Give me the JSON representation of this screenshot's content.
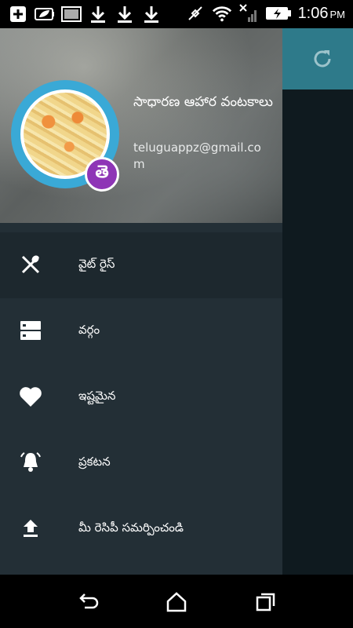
{
  "status_bar": {
    "time": "1:06",
    "ampm": "PM",
    "icons": [
      "add-icon",
      "leaf-battery-icon",
      "image-icon",
      "download-icon",
      "download-icon",
      "download-icon",
      "mute-icon",
      "wifi-icon",
      "no-signal-icon",
      "battery-charging-icon"
    ]
  },
  "drawer": {
    "app_name": "సాధారణ ఆహార వంటకాలు",
    "email": "teluguappz@gmail.com",
    "badge_letter": "తె",
    "menu": [
      {
        "label": "వైట్ రైస్",
        "icon": "fork-knife-icon",
        "active": true
      },
      {
        "label": "వర్గం",
        "icon": "category-list-icon",
        "active": false
      },
      {
        "label": "ఇష్టమైన",
        "icon": "heart-icon",
        "active": false
      },
      {
        "label": "ప్రకటన",
        "icon": "bell-icon",
        "active": false
      },
      {
        "label": "మీ రెసిపీ సమర్పించండి",
        "icon": "upload-icon",
        "active": false
      }
    ]
  },
  "colors": {
    "drawer_bg": "#232f36",
    "toolbar": "#2e7a8a",
    "avatar_ring": "#3aa9d6",
    "badge": "#8e35b6"
  }
}
